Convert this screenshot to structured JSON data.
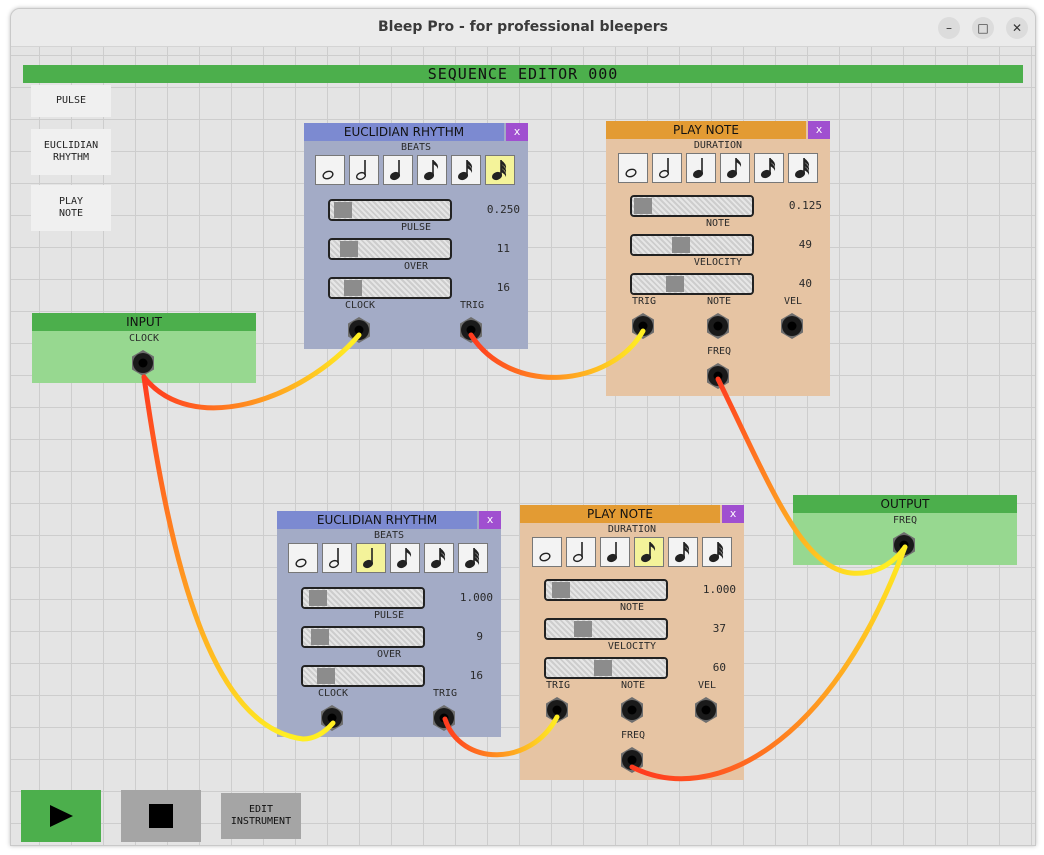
{
  "window": {
    "title": "Bleep Pro - for professional bleepers"
  },
  "sequence": {
    "header": "SEQUENCE EDITOR 000"
  },
  "palette": {
    "pulse": "PULSE",
    "euclidian": "EUCLIDIAN\nRHYTHM",
    "play_note": "PLAY\nNOTE"
  },
  "input": {
    "title": "INPUT",
    "clock": "CLOCK"
  },
  "output": {
    "title": "OUTPUT",
    "freq": "FREQ"
  },
  "euclid1": {
    "title": "EUCLIDIAN RHYTHM",
    "close": "x",
    "beats_label": "BEATS",
    "selected_note": 5,
    "beats_value": "0.250",
    "pulse_label": "PULSE",
    "pulse_value": "11",
    "over_label": "OVER",
    "over_value": "16",
    "clock_label": "CLOCK",
    "trig_label": "TRIG"
  },
  "euclid2": {
    "title": "EUCLIDIAN RHYTHM",
    "close": "x",
    "beats_label": "BEATS",
    "selected_note": 2,
    "beats_value": "1.000",
    "pulse_label": "PULSE",
    "pulse_value": "9",
    "over_label": "OVER",
    "over_value": "16",
    "clock_label": "CLOCK",
    "trig_label": "TRIG"
  },
  "play1": {
    "title": "PLAY NOTE",
    "close": "x",
    "duration_label": "DURATION",
    "selected_note": 6,
    "duration_value": "0.125",
    "note_label": "NOTE",
    "note_value": "49",
    "velocity_label": "VELOCITY",
    "velocity_value": "40",
    "trig_label": "TRIG",
    "note_jack_label": "NOTE",
    "vel_label": "VEL",
    "freq_label": "FREQ"
  },
  "play2": {
    "title": "PLAY NOTE",
    "close": "x",
    "duration_label": "DURATION",
    "selected_note": 3,
    "duration_value": "1.000",
    "note_label": "NOTE",
    "note_value": "37",
    "velocity_label": "VELOCITY",
    "velocity_value": "60",
    "trig_label": "TRIG",
    "note_jack_label": "NOTE",
    "vel_label": "VEL",
    "freq_label": "FREQ"
  },
  "transport": {
    "edit_instrument": "EDIT\nINSTRUMENT",
    "play_icon": "play-icon",
    "stop_icon": "stop-icon"
  },
  "colors": {
    "sequence_header": "#4caf4c",
    "euclid_header": "#7c8ad1",
    "euclid_body": "#a3abc6",
    "play_header": "#e39b33",
    "play_body": "#e6c4a3",
    "io_header": "#4caf4c",
    "io_body": "#97d890",
    "close_button": "#a04fd0",
    "selected_note": "#f4f39a",
    "play_button": "#4caf4c",
    "stop_button": "#a5a5a5",
    "cable_start": "#ff3b1f",
    "cable_end": "#ffee22"
  }
}
